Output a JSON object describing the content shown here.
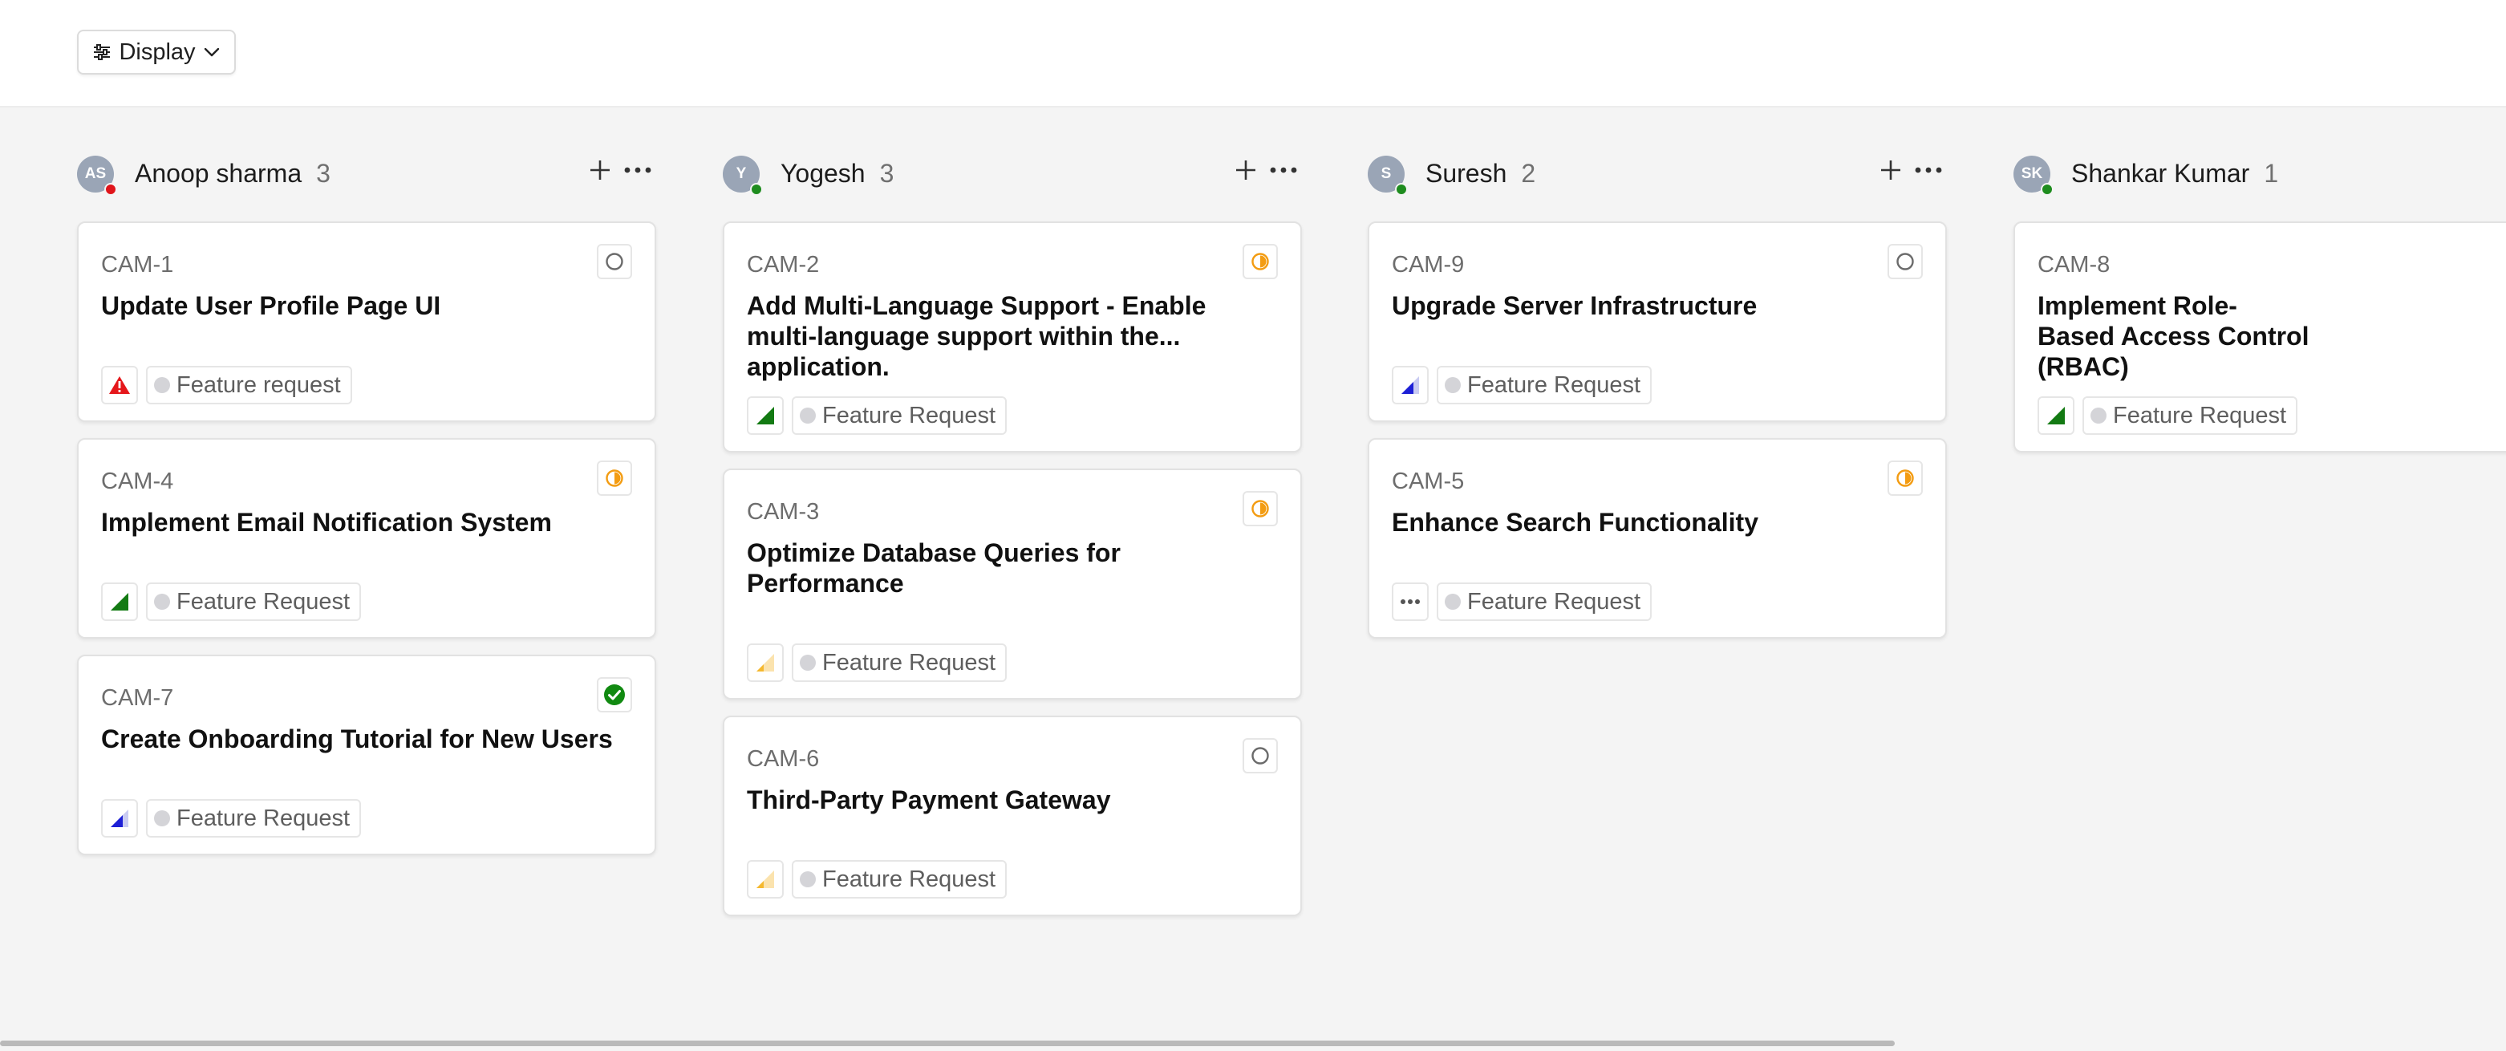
{
  "toolbar": {
    "display_label": "Display",
    "display_icon": "sliders-icon",
    "chevron_icon": "chevron-down-icon"
  },
  "colors": {
    "priority_urgent": "#e5171b",
    "priority_high": "#137a13",
    "priority_medium": "#1d1fd6",
    "priority_low": "#f5b82e",
    "status_in_progress": "#f39c12",
    "status_done": "#118a11",
    "presence_offline": "#e0141a",
    "presence_online": "#1e8c1e",
    "avatar_bg": "#9aa5b6"
  },
  "columns": [
    {
      "initials": "AS",
      "name": "Anoop sharma",
      "count": "3",
      "presence": "offline",
      "cards": [
        {
          "id": "CAM-1",
          "title": "Update User Profile Page UI",
          "status": "todo",
          "priority": "urgent",
          "label": "Feature request"
        },
        {
          "id": "CAM-4",
          "title": "Implement Email Notification System",
          "status": "in-progress",
          "priority": "high",
          "label": "Feature Request"
        },
        {
          "id": "CAM-7",
          "title": "Create Onboarding Tutorial for New Users",
          "status": "done",
          "priority": "medium",
          "label": "Feature Request"
        }
      ]
    },
    {
      "initials": "Y",
      "name": "Yogesh",
      "count": "3",
      "presence": "online",
      "cards": [
        {
          "id": "CAM-2",
          "title": "Add Multi-Language Support - Enable multi-language support within the... application.",
          "status": "in-progress",
          "priority": "high",
          "label": "Feature Request"
        },
        {
          "id": "CAM-3",
          "title": "Optimize Database Queries for Performance",
          "status": "in-progress",
          "priority": "low",
          "label": "Feature Request"
        },
        {
          "id": "CAM-6",
          "title": "Third-Party Payment Gateway",
          "status": "todo",
          "priority": "low",
          "label": "Feature Request"
        }
      ]
    },
    {
      "initials": "S",
      "name": "Suresh",
      "count": "2",
      "presence": "online",
      "cards": [
        {
          "id": "CAM-9",
          "title": "Upgrade Server Infrastructure",
          "status": "todo",
          "priority": "medium",
          "label": "Feature Request"
        },
        {
          "id": "CAM-5",
          "title": "Enhance Search Functionality",
          "status": "in-progress",
          "priority": "none",
          "label": "Feature Request"
        }
      ]
    },
    {
      "initials": "SK",
      "name": "Shankar Kumar",
      "count": "1",
      "presence": "online",
      "cards": [
        {
          "id": "CAM-8",
          "title": "Implement Role-Based Access Control (RBAC)",
          "status": "",
          "priority": "high",
          "label": "Feature Request"
        }
      ]
    }
  ]
}
